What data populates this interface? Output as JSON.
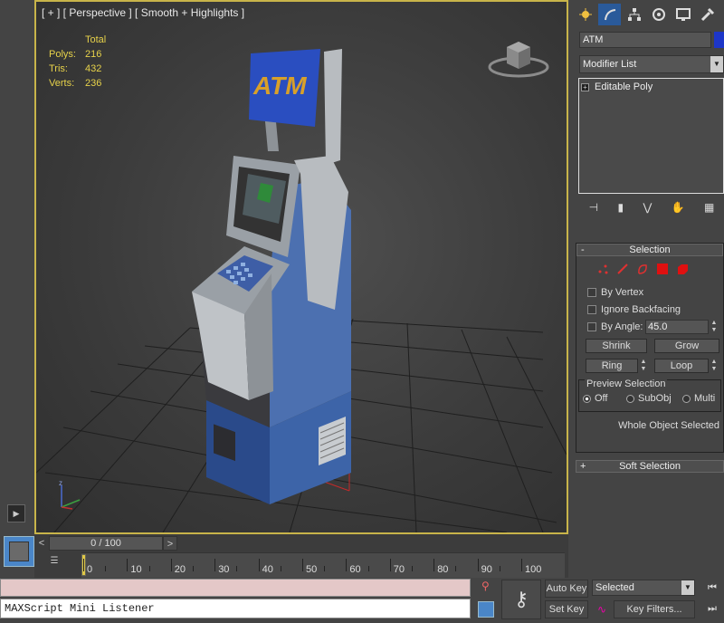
{
  "viewport": {
    "label": "[ + ] [ Perspective ] [ Smooth + Highlights ]",
    "stats": {
      "header": "Total",
      "rows": [
        {
          "key": "Polys:",
          "value": "216"
        },
        {
          "key": "Tris:",
          "value": "432"
        },
        {
          "key": "Verts:",
          "value": "236"
        }
      ]
    },
    "atm_sign_text": "ATM",
    "gizmo_axis_z": "z",
    "border_color": "#c8b44a"
  },
  "command_panel": {
    "tabs": [
      "create-icon",
      "modify-icon",
      "hierarchy-icon",
      "motion-icon",
      "display-icon",
      "utilities-icon"
    ],
    "object_name": "ATM",
    "object_color": "#1d36c8",
    "modifier_list_label": "Modifier List",
    "stack_items": [
      {
        "label": "Editable Poly",
        "expand": "+"
      }
    ],
    "stack_tools": [
      "pin-stack-icon",
      "show-end-result-icon",
      "make-unique-icon",
      "remove-modifier-icon",
      "configure-modifier-sets-icon"
    ]
  },
  "selection_rollout": {
    "title": "Selection",
    "collapse_sign": "-",
    "subobject_icons": [
      "vertex-icon",
      "edge-icon",
      "border-icon",
      "polygon-icon",
      "element-icon"
    ],
    "by_vertex": "By Vertex",
    "ignore_backfacing": "Ignore Backfacing",
    "by_angle": "By Angle:",
    "angle_value": "45.0",
    "shrink": "Shrink",
    "grow": "Grow",
    "ring": "Ring",
    "loop": "Loop",
    "preview_title": "Preview Selection",
    "preview_options": [
      {
        "label": "Off",
        "selected": true
      },
      {
        "label": "SubObj",
        "selected": false
      },
      {
        "label": "Multi",
        "selected": false
      }
    ],
    "status": "Whole Object Selected"
  },
  "soft_selection_rollout": {
    "title": "Soft Selection",
    "expand_sign": "+"
  },
  "timeline": {
    "prev": "<",
    "slider_text": "0 / 100",
    "next": ">",
    "ruler_labels": [
      "0",
      "10",
      "20",
      "30",
      "40",
      "50",
      "60",
      "70",
      "80",
      "90",
      "100"
    ],
    "current_frame": 0,
    "max_frame": 100
  },
  "bottom": {
    "listener_label": "MAXScript Mini Listener",
    "auto_key": "Auto Key",
    "set_key": "Set Key",
    "key_mode_selected": "Selected",
    "key_filters": "Key Filters...",
    "status_color": "#e4c8c8"
  }
}
